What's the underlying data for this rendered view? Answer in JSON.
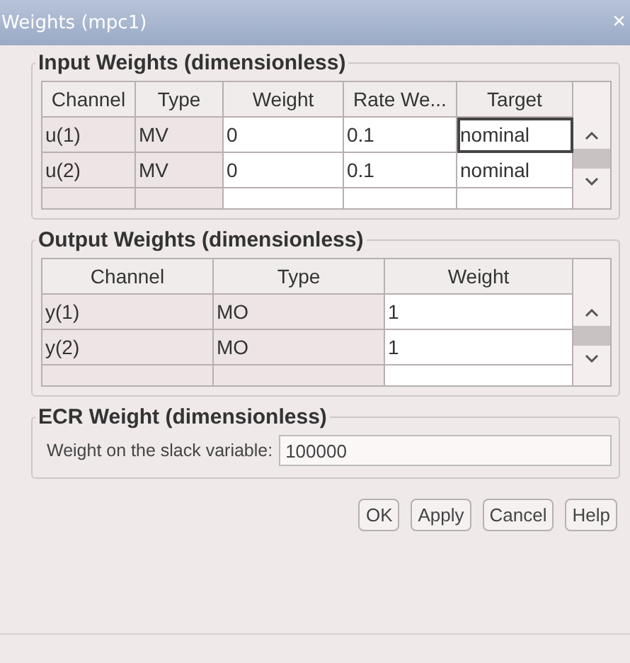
{
  "window": {
    "title": "Weights (mpc1)",
    "close": "×"
  },
  "input_weights": {
    "title": "Input Weights (dimensionless)",
    "columns": [
      "Channel",
      "Type",
      "Weight",
      "Rate We...",
      "Target"
    ],
    "rows": [
      {
        "cells": [
          "u(1)",
          "MV",
          "0",
          "0.1",
          "nominal"
        ],
        "target_focused": true
      },
      {
        "cells": [
          "u(2)",
          "MV",
          "0",
          "0.1",
          "nominal"
        ],
        "target_focused": false
      }
    ]
  },
  "output_weights": {
    "title": "Output Weights (dimensionless)",
    "columns": [
      "Channel",
      "Type",
      "Weight"
    ],
    "rows": [
      {
        "cells": [
          "y(1)",
          "MO",
          "1"
        ]
      },
      {
        "cells": [
          "y(2)",
          "MO",
          "1"
        ]
      }
    ]
  },
  "ecr_weight": {
    "title": "ECR Weight (dimensionless)",
    "label": "Weight on the slack variable:",
    "value": "100000"
  },
  "buttons": [
    "OK",
    "Apply",
    "Cancel",
    "Help"
  ]
}
